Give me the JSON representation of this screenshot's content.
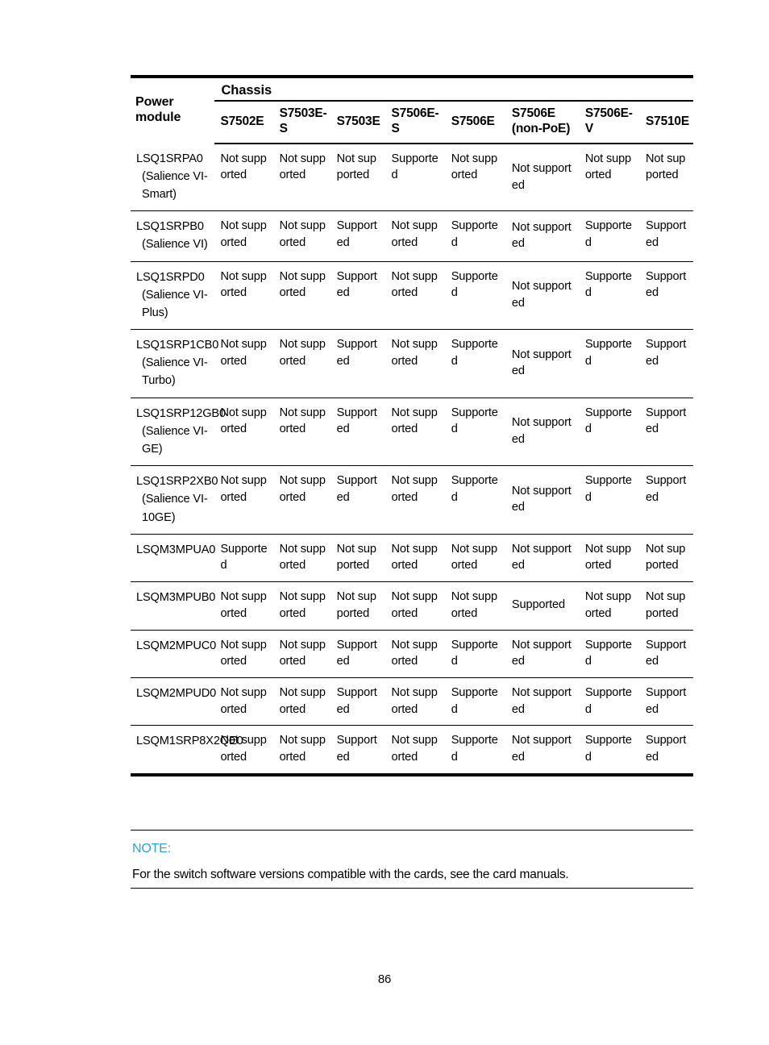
{
  "page": {
    "number": "86"
  },
  "table": {
    "group_header": "Chassis",
    "row_header_label": "Power module",
    "columns": [
      "S7502E",
      "S7503E-S",
      "S7503E",
      "S7506E-S",
      "S7506E",
      "S7506E (non-PoE)",
      "S7506E-V",
      "S7510E"
    ],
    "rows": [
      {
        "module": "LSQ1SRPA0",
        "module_sub": "(Salience VI-Smart)",
        "values": [
          "Not supported",
          "Not supported",
          "Not supported",
          "Supported",
          "Not supported",
          "Not supported",
          "Not supported",
          "Not supported"
        ]
      },
      {
        "module": "LSQ1SRPB0",
        "module_sub": "(Salience VI)",
        "values": [
          "Not supported",
          "Not supported",
          "Supported",
          "Not supported",
          "Supported",
          "Not supported",
          "Supported",
          "Supported"
        ]
      },
      {
        "module": "LSQ1SRPD0",
        "module_sub": "(Salience VI-Plus)",
        "values": [
          "Not supported",
          "Not supported",
          "Supported",
          "Not supported",
          "Supported",
          "Not supported",
          "Supported",
          "Supported"
        ]
      },
      {
        "module": "LSQ1SRP1CB0",
        "module_sub": "(Salience VI-Turbo)",
        "values": [
          "Not supported",
          "Not supported",
          "Supported",
          "Not supported",
          "Supported",
          "Not supported",
          "Supported",
          "Supported"
        ]
      },
      {
        "module": "LSQ1SRP12GB0",
        "module_sub": "(Salience VI-GE)",
        "values": [
          "Not supported",
          "Not supported",
          "Supported",
          "Not supported",
          "Supported",
          "Not supported",
          "Supported",
          "Supported"
        ]
      },
      {
        "module": "LSQ1SRP2XB0",
        "module_sub": "(Salience VI-10GE)",
        "values": [
          "Not supported",
          "Not supported",
          "Supported",
          "Not supported",
          "Supported",
          "Not supported",
          "Supported",
          "Supported"
        ]
      },
      {
        "module": "LSQM3MPUA0",
        "module_sub": "",
        "values": [
          "Supported",
          "Not supported",
          "Not supported",
          "Not supported",
          "Not supported",
          "Not supported",
          "Not supported",
          "Not supported"
        ]
      },
      {
        "module": "LSQM3MPUB0",
        "module_sub": "",
        "values": [
          "Not supported",
          "Not supported",
          "Not supported",
          "Not supported",
          "Not supported",
          "Supported",
          "Not supported",
          "Not supported"
        ]
      },
      {
        "module": "LSQM2MPUC0",
        "module_sub": "",
        "values": [
          "Not supported",
          "Not supported",
          "Supported",
          "Not supported",
          "Supported",
          "Not supported",
          "Supported",
          "Supported"
        ]
      },
      {
        "module": "LSQM2MPUD0",
        "module_sub": "",
        "values": [
          "Not supported",
          "Not supported",
          "Supported",
          "Not supported",
          "Supported",
          "Not supported",
          "Supported",
          "Supported"
        ]
      },
      {
        "module": "LSQM1SRP8X2QE0",
        "module_sub": "",
        "values": [
          "Not supported",
          "Not supported",
          "Supported",
          "Not supported",
          "Supported",
          "Not supported",
          "Supported",
          "Supported"
        ]
      }
    ]
  },
  "note": {
    "label": "NOTE:",
    "text": "For the switch software versions compatible with the cards, see the card manuals.",
    "label_color": "#29a3dc"
  }
}
